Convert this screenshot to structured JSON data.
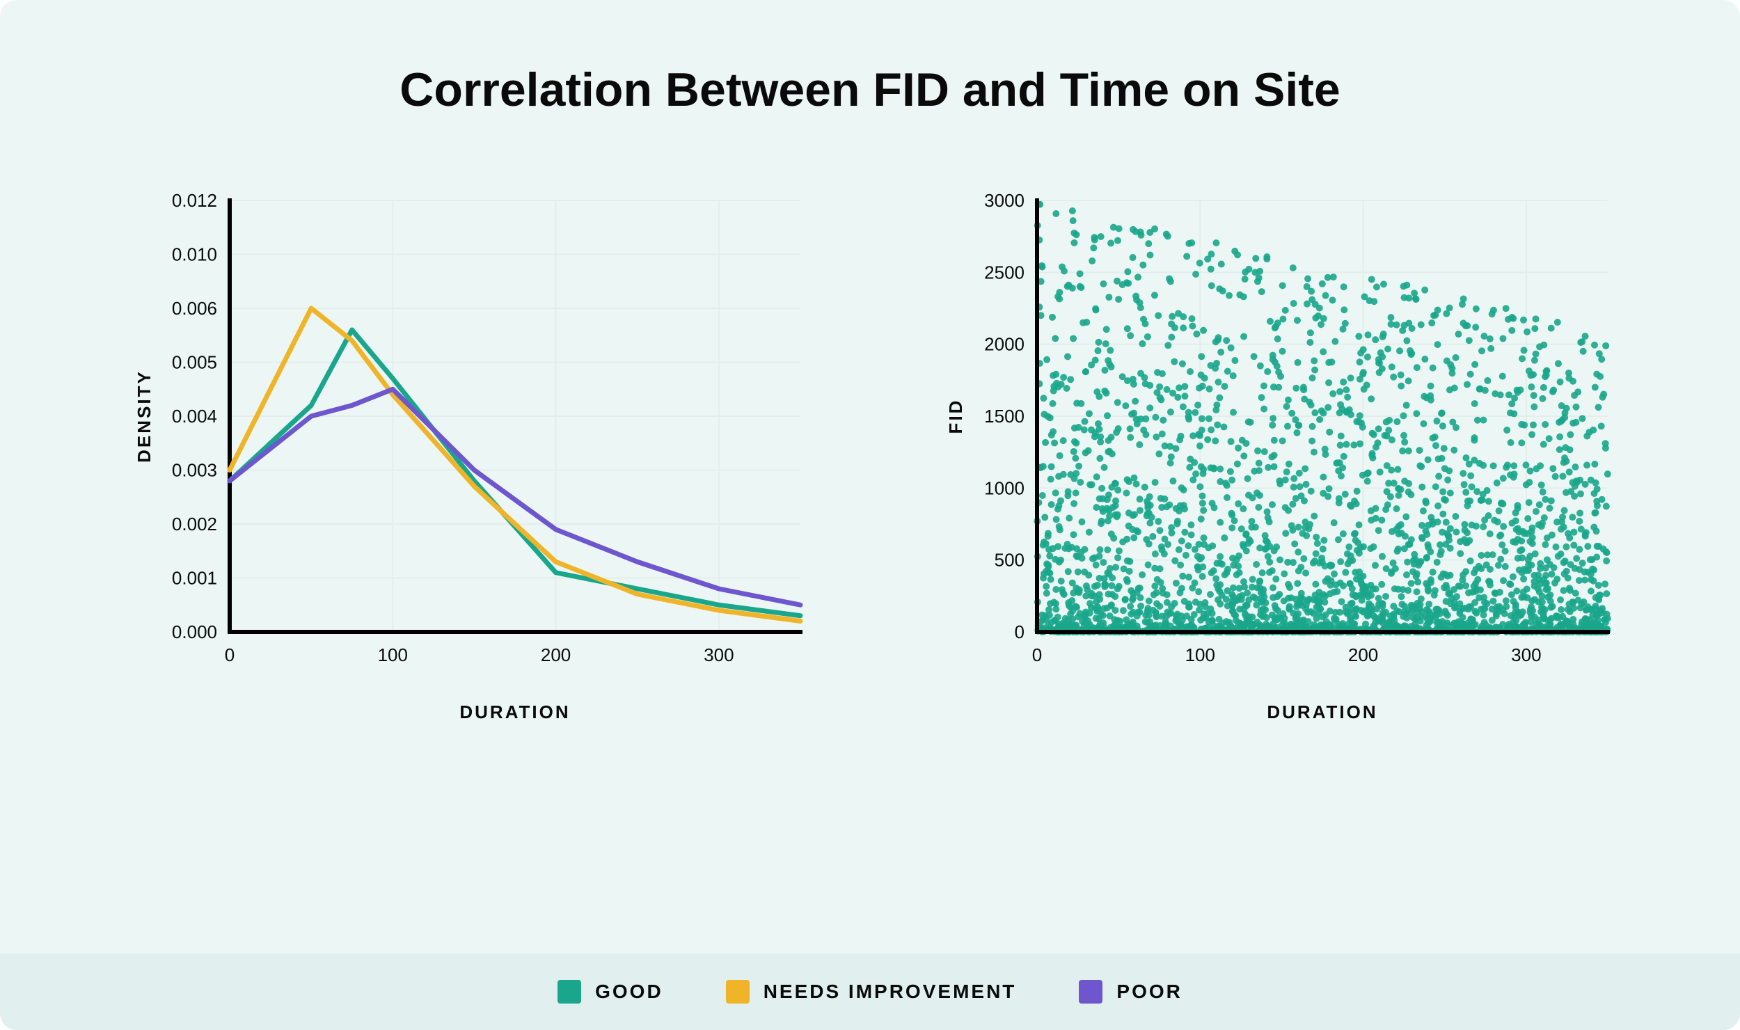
{
  "title": "Correlation Between FID and Time on Site",
  "legend": {
    "good": "GOOD",
    "needs": "NEEDS IMPROVEMENT",
    "poor": "POOR"
  },
  "colors": {
    "good": "#1aa68b",
    "needs": "#f0b429",
    "poor": "#6e56cf",
    "axis": "#000000",
    "grid": "#e3eeeb",
    "scatter": "#1aa68b"
  },
  "chart_data": [
    {
      "type": "line",
      "title": "",
      "xlabel": "DURATION",
      "ylabel": "DENSITY",
      "xlim": [
        0,
        350
      ],
      "ylim": [
        0,
        0.012
      ],
      "xticks": [
        0,
        100,
        200,
        300
      ],
      "yticks": [
        0.0,
        0.001,
        0.002,
        0.003,
        0.004,
        0.005,
        0.006,
        0.01,
        0.012
      ],
      "ytick_labels": [
        "0.000",
        "0.001",
        "0.002",
        "0.003",
        "0.004",
        "0.005",
        "0.006",
        "0.010",
        "0.012"
      ],
      "x": [
        0,
        50,
        75,
        100,
        150,
        200,
        250,
        300,
        350
      ],
      "series": [
        {
          "name": "GOOD",
          "color": "#1aa68b",
          "values": [
            0.0028,
            0.0042,
            0.0056,
            0.0047,
            0.0028,
            0.0011,
            0.0008,
            0.0005,
            0.0003
          ]
        },
        {
          "name": "NEEDS IMPROVEMENT",
          "color": "#f0b429",
          "values": [
            0.003,
            0.006,
            0.0054,
            0.0044,
            0.0027,
            0.0013,
            0.0007,
            0.0004,
            0.0002
          ]
        },
        {
          "name": "POOR",
          "color": "#6e56cf",
          "values": [
            0.0028,
            0.004,
            0.0042,
            0.0045,
            0.003,
            0.0019,
            0.0013,
            0.0008,
            0.0005
          ]
        }
      ]
    },
    {
      "type": "scatter",
      "title": "",
      "xlabel": "DURATION",
      "ylabel": "FID",
      "xlim": [
        0,
        350
      ],
      "ylim": [
        0,
        3000
      ],
      "xticks": [
        0,
        100,
        200,
        300
      ],
      "yticks": [
        0,
        500,
        1000,
        1500,
        2000,
        2500,
        3000
      ],
      "n_points_approx": 3000,
      "seed": 42,
      "note": "Dense cloud concentrated at low FID across full duration range; density decreases at higher FID; sparse outliers up to ~3000."
    }
  ]
}
